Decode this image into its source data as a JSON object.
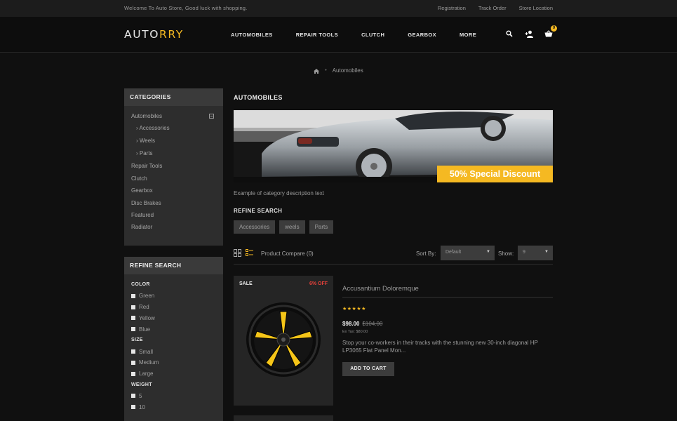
{
  "topbar": {
    "welcome": "Welcome To Auto Store, Good luck with shopping.",
    "links": [
      "Registration",
      "Track Order",
      "Store Location"
    ]
  },
  "header": {
    "logo_a": "AUTO",
    "logo_b": "RRY",
    "nav": [
      "AUTOMOBILES",
      "REPAIR TOOLS",
      "CLUTCH",
      "GEARBOX",
      "MORE"
    ],
    "icons": [
      "search-icon",
      "user-add-icon",
      "basket-icon"
    ],
    "cart_count": "0",
    "accent_color": "#f5b922"
  },
  "breadcrumb": {
    "home_icon": "home-icon",
    "current": "Automobiles"
  },
  "sidebar": {
    "categories_title": "CATEGORIES",
    "categories": [
      {
        "label": "Automobiles",
        "sub": false
      },
      {
        "label": "› Accessories",
        "sub": true
      },
      {
        "label": "› Weels",
        "sub": true
      },
      {
        "label": "› Parts",
        "sub": true
      },
      {
        "label": "Repair Tools",
        "sub": false
      },
      {
        "label": "Clutch",
        "sub": false
      },
      {
        "label": "Gearbox",
        "sub": false
      },
      {
        "label": "Disc Brakes",
        "sub": false
      },
      {
        "label": "Featured",
        "sub": false
      },
      {
        "label": "Radiator",
        "sub": false
      }
    ],
    "refine_title": "REFINE SEARCH",
    "color_title": "COLOR",
    "colors": [
      "Green",
      "Red",
      "Yellow",
      "Blue"
    ],
    "size_title": "SIZE",
    "sizes": [
      "Small",
      "Medium",
      "Large"
    ],
    "weight_title": "WEIGHT",
    "weights": [
      "5",
      "10"
    ]
  },
  "main": {
    "title": "AUTOMOBILES",
    "banner_badge": "50% Special Discount",
    "description": "Example of category description text",
    "refine_title": "REFINE SEARCH",
    "tags": [
      "Accessories",
      "weels",
      "Parts"
    ],
    "compare": "Product Compare (0)",
    "sort_label": "Sort By:",
    "sort_value": "Default",
    "show_label": "Show:",
    "show_value": "9"
  },
  "product": {
    "sale_label": "SALE",
    "discount_label": "6% OFF",
    "name": "Accusantium Doloremque",
    "rating": 5,
    "stars": "★★★★★",
    "price_new": "$98.00",
    "price_old": "$104.00",
    "ex_tax": "Ex Tax: $80.00",
    "description": "Stop your co-workers in their tracks with the stunning new 30-inch diagonal HP LP3065 Flat Panel Mon...",
    "add_to_cart": "ADD TO CART"
  }
}
